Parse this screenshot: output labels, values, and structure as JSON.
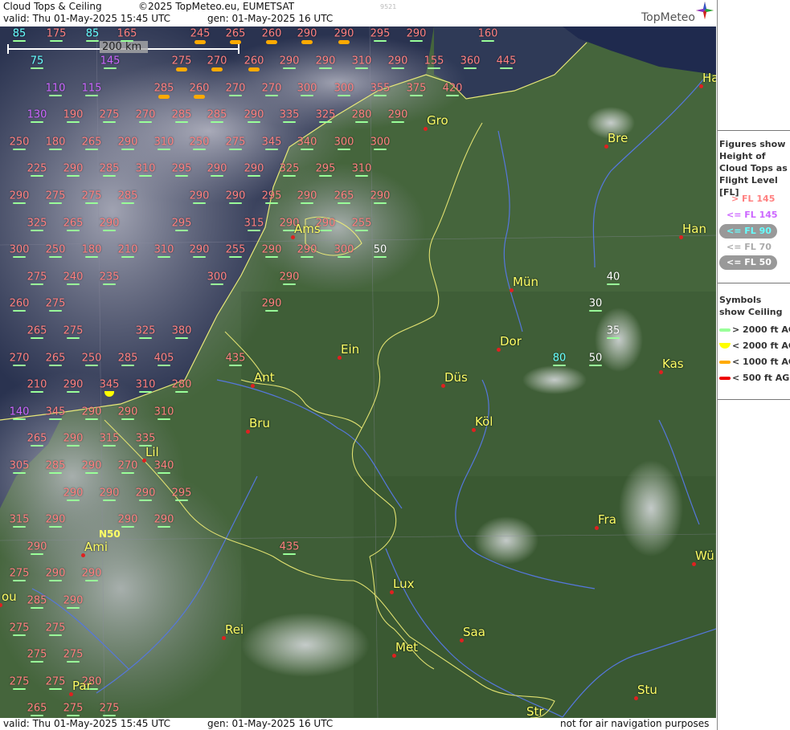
{
  "header": {
    "title": "Cloud Tops & Ceiling",
    "copyright": "©2025 TopMeteo.eu, EUMETSAT",
    "valid": "valid:  Thu  01-May-2025  15:45 UTC",
    "gen": "gen: 01-May-2025 16 UTC",
    "frame_id": "9521",
    "logo": "TopMeteo"
  },
  "footer": {
    "valid": "valid:  Thu  01-May-2025  15:45 UTC",
    "gen": "gen: 01-May-2025 16 UTC",
    "disclaimer": "not for air navigation purposes"
  },
  "scale_label": "200 km",
  "legend": {
    "figures_title": "Figures show Height of Cloud Tops as Flight Level  [FL]",
    "levels": [
      {
        "label": "> FL 145",
        "color": "#ff8080"
      },
      {
        "label": "<= FL 145",
        "color": "#cc66ff"
      },
      {
        "label": "<= FL 90",
        "color": "#66ffff"
      },
      {
        "label": "<= FL 70",
        "color": "#aaaaaa"
      },
      {
        "label": "<= FL 50",
        "color": "#ffffff"
      }
    ],
    "symbols_title": "Symbols show Ceiling",
    "symbols": [
      {
        "label": "> 2000 ft AGL",
        "color": "#99ff99"
      },
      {
        "label": "< 2000 ft AGL",
        "color": "#ffff00"
      },
      {
        "label": "< 1000 ft AGL",
        "color": "#ffaa00"
      },
      {
        "label": "< 500 ft AGL",
        "color": "#ee0000"
      }
    ]
  },
  "cities": [
    {
      "name": "Gro"
    },
    {
      "name": "Bre"
    },
    {
      "name": "Ha"
    },
    {
      "name": "Ams"
    },
    {
      "name": "Han"
    },
    {
      "name": "Mün"
    },
    {
      "name": "Dor"
    },
    {
      "name": "Ein"
    },
    {
      "name": "Ant"
    },
    {
      "name": "Düs"
    },
    {
      "name": "Kas"
    },
    {
      "name": "Bru"
    },
    {
      "name": "Köl"
    },
    {
      "name": "Lil"
    },
    {
      "name": "Fra"
    },
    {
      "name": "Ami"
    },
    {
      "name": "Wü"
    },
    {
      "name": "Lux"
    },
    {
      "name": "Rei"
    },
    {
      "name": "Saa"
    },
    {
      "name": "Met"
    },
    {
      "name": "Par"
    },
    {
      "name": "Stu"
    },
    {
      "name": "Str"
    },
    {
      "name": "ou"
    }
  ],
  "grid_label": "N50",
  "observations": [
    {
      "v": "85",
      "c": "#66ffff"
    },
    {
      "v": "175",
      "c": "#ff8080"
    },
    {
      "v": "85",
      "c": "#66ffff"
    },
    {
      "v": "165",
      "c": "#ff8080"
    },
    {
      "v": "245",
      "c": "#ff8080",
      "s": "#ffaa00"
    },
    {
      "v": "265",
      "c": "#ff8080",
      "s": "#ffaa00"
    },
    {
      "v": "260",
      "c": "#ff8080",
      "s": "#ffaa00"
    },
    {
      "v": "290",
      "c": "#ff8080",
      "s": "#ffaa00"
    },
    {
      "v": "290",
      "c": "#ff8080",
      "s": "#ffaa00"
    },
    {
      "v": "295",
      "c": "#ff8080"
    },
    {
      "v": "290",
      "c": "#ff8080"
    },
    {
      "v": "160",
      "c": "#ff8080"
    },
    {
      "v": "75",
      "c": "#66ffff"
    },
    {
      "v": "145",
      "c": "#cc66ff"
    },
    {
      "v": "275",
      "c": "#ff8080",
      "s": "#ffaa00"
    },
    {
      "v": "270",
      "c": "#ff8080",
      "s": "#ffaa00"
    },
    {
      "v": "260",
      "c": "#ff8080",
      "s": "#ffaa00"
    },
    {
      "v": "290",
      "c": "#ff8080"
    },
    {
      "v": "290",
      "c": "#ff8080"
    },
    {
      "v": "310",
      "c": "#ff8080"
    },
    {
      "v": "290",
      "c": "#ff8080"
    },
    {
      "v": "155",
      "c": "#ff8080"
    },
    {
      "v": "360",
      "c": "#ff8080"
    },
    {
      "v": "445",
      "c": "#ff8080"
    },
    {
      "v": "110",
      "c": "#cc66ff"
    },
    {
      "v": "115",
      "c": "#cc66ff"
    },
    {
      "v": "285",
      "c": "#ff8080",
      "s": "#ffaa00"
    },
    {
      "v": "260",
      "c": "#ff8080",
      "s": "#ffaa00"
    },
    {
      "v": "270",
      "c": "#ff8080"
    },
    {
      "v": "270",
      "c": "#ff8080"
    },
    {
      "v": "300",
      "c": "#ff8080"
    },
    {
      "v": "300",
      "c": "#ff8080"
    },
    {
      "v": "355",
      "c": "#ff8080"
    },
    {
      "v": "375",
      "c": "#ff8080"
    },
    {
      "v": "420",
      "c": "#ff8080"
    },
    {
      "v": "130",
      "c": "#cc66ff"
    },
    {
      "v": "190",
      "c": "#ff8080"
    },
    {
      "v": "275",
      "c": "#ff8080"
    },
    {
      "v": "270",
      "c": "#ff8080"
    },
    {
      "v": "285",
      "c": "#ff8080"
    },
    {
      "v": "285",
      "c": "#ff8080"
    },
    {
      "v": "290",
      "c": "#ff8080"
    },
    {
      "v": "335",
      "c": "#ff8080"
    },
    {
      "v": "325",
      "c": "#ff8080"
    },
    {
      "v": "280",
      "c": "#ff8080"
    },
    {
      "v": "290",
      "c": "#ff8080"
    },
    {
      "v": "250",
      "c": "#ff8080"
    },
    {
      "v": "180",
      "c": "#ff8080"
    },
    {
      "v": "265",
      "c": "#ff8080"
    },
    {
      "v": "290",
      "c": "#ff8080"
    },
    {
      "v": "310",
      "c": "#ff8080"
    },
    {
      "v": "250",
      "c": "#ff8080"
    },
    {
      "v": "275",
      "c": "#ff8080"
    },
    {
      "v": "345",
      "c": "#ff8080"
    },
    {
      "v": "340",
      "c": "#ff8080"
    },
    {
      "v": "300",
      "c": "#ff8080"
    },
    {
      "v": "300",
      "c": "#ff8080"
    },
    {
      "v": "225",
      "c": "#ff8080"
    },
    {
      "v": "290",
      "c": "#ff8080"
    },
    {
      "v": "285",
      "c": "#ff8080"
    },
    {
      "v": "310",
      "c": "#ff8080"
    },
    {
      "v": "295",
      "c": "#ff8080"
    },
    {
      "v": "290",
      "c": "#ff8080"
    },
    {
      "v": "290",
      "c": "#ff8080"
    },
    {
      "v": "325",
      "c": "#ff8080"
    },
    {
      "v": "295",
      "c": "#ff8080"
    },
    {
      "v": "310",
      "c": "#ff8080"
    },
    {
      "v": "290",
      "c": "#ff8080"
    },
    {
      "v": "275",
      "c": "#ff8080"
    },
    {
      "v": "275",
      "c": "#ff8080"
    },
    {
      "v": "285",
      "c": "#ff8080"
    },
    {
      "v": "290",
      "c": "#ff8080"
    },
    {
      "v": "290",
      "c": "#ff8080"
    },
    {
      "v": "295",
      "c": "#ff8080"
    },
    {
      "v": "290",
      "c": "#ff8080"
    },
    {
      "v": "265",
      "c": "#ff8080"
    },
    {
      "v": "290",
      "c": "#ff8080"
    },
    {
      "v": "325",
      "c": "#ff8080"
    },
    {
      "v": "265",
      "c": "#ff8080"
    },
    {
      "v": "290",
      "c": "#ff8080"
    },
    {
      "v": "295",
      "c": "#ff8080"
    },
    {
      "v": "315",
      "c": "#ff8080"
    },
    {
      "v": "290",
      "c": "#ff8080"
    },
    {
      "v": "290",
      "c": "#ff8080"
    },
    {
      "v": "255",
      "c": "#ff8080"
    },
    {
      "v": "300",
      "c": "#ff8080"
    },
    {
      "v": "250",
      "c": "#ff8080"
    },
    {
      "v": "180",
      "c": "#ff8080"
    },
    {
      "v": "210",
      "c": "#ff8080"
    },
    {
      "v": "310",
      "c": "#ff8080"
    },
    {
      "v": "290",
      "c": "#ff8080"
    },
    {
      "v": "255",
      "c": "#ff8080"
    },
    {
      "v": "290",
      "c": "#ff8080"
    },
    {
      "v": "290",
      "c": "#ff8080"
    },
    {
      "v": "300",
      "c": "#ff8080"
    },
    {
      "v": "50",
      "c": "#ffffff"
    },
    {
      "v": "275",
      "c": "#ff8080"
    },
    {
      "v": "240",
      "c": "#ff8080"
    },
    {
      "v": "235",
      "c": "#ff8080"
    },
    {
      "v": "300",
      "c": "#ff8080"
    },
    {
      "v": "290",
      "c": "#ff8080"
    },
    {
      "v": "40",
      "c": "#ffffff"
    },
    {
      "v": "260",
      "c": "#ff8080"
    },
    {
      "v": "275",
      "c": "#ff8080"
    },
    {
      "v": "290",
      "c": "#ff8080"
    },
    {
      "v": "30",
      "c": "#ffffff"
    },
    {
      "v": "265",
      "c": "#ff8080"
    },
    {
      "v": "275",
      "c": "#ff8080"
    },
    {
      "v": "325",
      "c": "#ff8080"
    },
    {
      "v": "380",
      "c": "#ff8080"
    },
    {
      "v": "35",
      "c": "#ffffff"
    },
    {
      "v": "270",
      "c": "#ff8080"
    },
    {
      "v": "265",
      "c": "#ff8080"
    },
    {
      "v": "250",
      "c": "#ff8080"
    },
    {
      "v": "285",
      "c": "#ff8080"
    },
    {
      "v": "405",
      "c": "#ff8080"
    },
    {
      "v": "435",
      "c": "#ff8080"
    },
    {
      "v": "80",
      "c": "#66ffff"
    },
    {
      "v": "50",
      "c": "#ffffff"
    },
    {
      "v": "210",
      "c": "#ff8080"
    },
    {
      "v": "290",
      "c": "#ff8080"
    },
    {
      "v": "345",
      "c": "#ff8080",
      "s": "#ffff00"
    },
    {
      "v": "310",
      "c": "#ff8080"
    },
    {
      "v": "280",
      "c": "#ff8080"
    },
    {
      "v": "140",
      "c": "#cc66ff"
    },
    {
      "v": "345",
      "c": "#ff8080"
    },
    {
      "v": "290",
      "c": "#ff8080"
    },
    {
      "v": "290",
      "c": "#ff8080"
    },
    {
      "v": "310",
      "c": "#ff8080"
    },
    {
      "v": "265",
      "c": "#ff8080"
    },
    {
      "v": "290",
      "c": "#ff8080"
    },
    {
      "v": "315",
      "c": "#ff8080"
    },
    {
      "v": "335",
      "c": "#ff8080"
    },
    {
      "v": "305",
      "c": "#ff8080"
    },
    {
      "v": "285",
      "c": "#ff8080"
    },
    {
      "v": "290",
      "c": "#ff8080"
    },
    {
      "v": "270",
      "c": "#ff8080"
    },
    {
      "v": "340",
      "c": "#ff8080"
    },
    {
      "v": "290",
      "c": "#ff8080"
    },
    {
      "v": "290",
      "c": "#ff8080"
    },
    {
      "v": "290",
      "c": "#ff8080"
    },
    {
      "v": "295",
      "c": "#ff8080"
    },
    {
      "v": "315",
      "c": "#ff8080"
    },
    {
      "v": "290",
      "c": "#ff8080"
    },
    {
      "v": "290",
      "c": "#ff8080"
    },
    {
      "v": "290",
      "c": "#ff8080"
    },
    {
      "v": "290",
      "c": "#ff8080"
    },
    {
      "v": "435",
      "c": "#ff8080"
    },
    {
      "v": "275",
      "c": "#ff8080"
    },
    {
      "v": "290",
      "c": "#ff8080"
    },
    {
      "v": "290",
      "c": "#ff8080"
    },
    {
      "v": "285",
      "c": "#ff8080"
    },
    {
      "v": "290",
      "c": "#ff8080"
    },
    {
      "v": "275",
      "c": "#ff8080"
    },
    {
      "v": "275",
      "c": "#ff8080"
    },
    {
      "v": "275",
      "c": "#ff8080"
    },
    {
      "v": "275",
      "c": "#ff8080"
    },
    {
      "v": "275",
      "c": "#ff8080"
    },
    {
      "v": "275",
      "c": "#ff8080"
    },
    {
      "v": "280",
      "c": "#ff8080"
    },
    {
      "v": "265",
      "c": "#ff8080"
    },
    {
      "v": "275",
      "c": "#ff8080"
    },
    {
      "v": "275",
      "c": "#ff8080"
    }
  ]
}
